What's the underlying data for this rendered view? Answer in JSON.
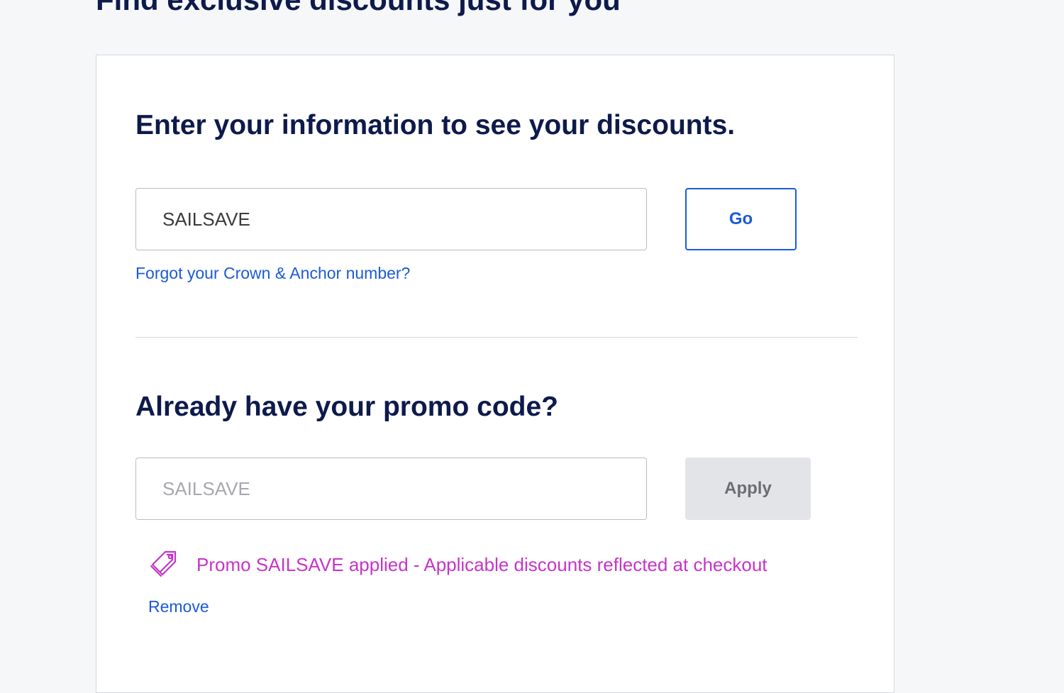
{
  "page": {
    "heading": "Find exclusive discounts just for you"
  },
  "member_section": {
    "title": "Enter your information to see your discounts.",
    "input_value": "SAILSAVE",
    "go_label": "Go",
    "forgot_link": "Forgot your Crown & Anchor number?"
  },
  "promo_section": {
    "title": "Already have your promo code?",
    "input_placeholder": "SAILSAVE",
    "apply_label": "Apply",
    "status_icon": "tag-icon",
    "status_message": "Promo SAILSAVE applied - Applicable discounts reflected at checkout",
    "remove_label": "Remove"
  },
  "colors": {
    "navy": "#0d1a4b",
    "link_blue": "#1b5bd6",
    "promo_magenta": "#c634c9",
    "disabled_gray": "#e3e4e7"
  }
}
